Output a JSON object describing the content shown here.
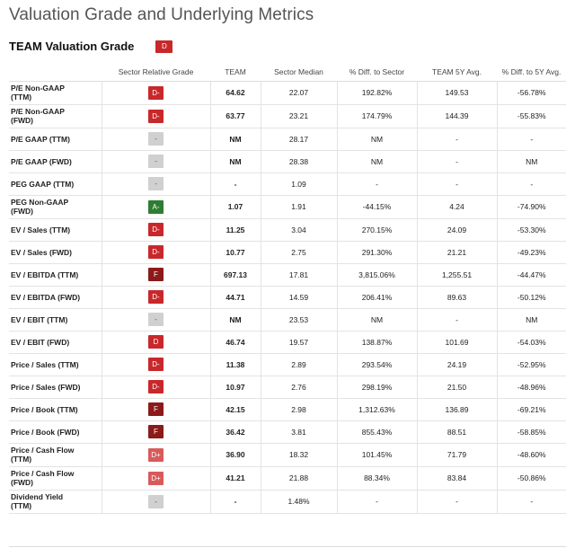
{
  "page": {
    "title": "Valuation Grade and Underlying Metrics",
    "subtitle": "TEAM Valuation Grade",
    "overall_grade": "D"
  },
  "colors": {
    "red": "#c8282b",
    "dark_red": "#8b1a1a",
    "light_red": "#d85a5a",
    "gray": "#d0d0d0",
    "green": "#2e7d32"
  },
  "table": {
    "headers": [
      "",
      "Sector Relative Grade",
      "TEAM",
      "Sector Median",
      "% Diff. to Sector",
      "TEAM 5Y Avg.",
      "% Diff. to 5Y Avg."
    ],
    "rows": [
      {
        "metric": "P/E Non-GAAP\n(TTM)",
        "grade": "D-",
        "color": "red",
        "team": "64.62",
        "median": "22.07",
        "diff_sector": "192.82%",
        "avg5y": "149.53",
        "diff_5y": "-56.78%"
      },
      {
        "metric": "P/E Non-GAAP\n(FWD)",
        "grade": "D-",
        "color": "red",
        "team": "63.77",
        "median": "23.21",
        "diff_sector": "174.79%",
        "avg5y": "144.39",
        "diff_5y": "-55.83%"
      },
      {
        "metric": "P/E GAAP (TTM)",
        "grade": "-",
        "color": "gray",
        "team": "NM",
        "median": "28.17",
        "diff_sector": "NM",
        "avg5y": "-",
        "diff_5y": "-"
      },
      {
        "metric": "P/E GAAP (FWD)",
        "grade": "-",
        "color": "gray",
        "team": "NM",
        "median": "28.38",
        "diff_sector": "NM",
        "avg5y": "-",
        "diff_5y": "NM"
      },
      {
        "metric": "PEG GAAP (TTM)",
        "grade": "-",
        "color": "gray",
        "team": "-",
        "median": "1.09",
        "diff_sector": "-",
        "avg5y": "-",
        "diff_5y": "-"
      },
      {
        "metric": "PEG Non-GAAP\n(FWD)",
        "grade": "A-",
        "color": "green",
        "team": "1.07",
        "median": "1.91",
        "diff_sector": "-44.15%",
        "avg5y": "4.24",
        "diff_5y": "-74.90%"
      },
      {
        "metric": "EV / Sales (TTM)",
        "grade": "D-",
        "color": "red",
        "team": "11.25",
        "median": "3.04",
        "diff_sector": "270.15%",
        "avg5y": "24.09",
        "diff_5y": "-53.30%"
      },
      {
        "metric": "EV / Sales (FWD)",
        "grade": "D-",
        "color": "red",
        "team": "10.77",
        "median": "2.75",
        "diff_sector": "291.30%",
        "avg5y": "21.21",
        "diff_5y": "-49.23%"
      },
      {
        "metric": "EV / EBITDA (TTM)",
        "grade": "F",
        "color": "dark_red",
        "team": "697.13",
        "median": "17.81",
        "diff_sector": "3,815.06%",
        "avg5y": "1,255.51",
        "diff_5y": "-44.47%"
      },
      {
        "metric": "EV / EBITDA (FWD)",
        "grade": "D-",
        "color": "red",
        "team": "44.71",
        "median": "14.59",
        "diff_sector": "206.41%",
        "avg5y": "89.63",
        "diff_5y": "-50.12%"
      },
      {
        "metric": "EV / EBIT (TTM)",
        "grade": "-",
        "color": "gray",
        "team": "NM",
        "median": "23.53",
        "diff_sector": "NM",
        "avg5y": "-",
        "diff_5y": "NM"
      },
      {
        "metric": "EV / EBIT (FWD)",
        "grade": "D",
        "color": "red",
        "team": "46.74",
        "median": "19.57",
        "diff_sector": "138.87%",
        "avg5y": "101.69",
        "diff_5y": "-54.03%"
      },
      {
        "metric": "Price / Sales (TTM)",
        "grade": "D-",
        "color": "red",
        "team": "11.38",
        "median": "2.89",
        "diff_sector": "293.54%",
        "avg5y": "24.19",
        "diff_5y": "-52.95%"
      },
      {
        "metric": "Price / Sales (FWD)",
        "grade": "D-",
        "color": "red",
        "team": "10.97",
        "median": "2.76",
        "diff_sector": "298.19%",
        "avg5y": "21.50",
        "diff_5y": "-48.96%"
      },
      {
        "metric": "Price / Book (TTM)",
        "grade": "F",
        "color": "dark_red",
        "team": "42.15",
        "median": "2.98",
        "diff_sector": "1,312.63%",
        "avg5y": "136.89",
        "diff_5y": "-69.21%"
      },
      {
        "metric": "Price / Book (FWD)",
        "grade": "F",
        "color": "dark_red",
        "team": "36.42",
        "median": "3.81",
        "diff_sector": "855.43%",
        "avg5y": "88.51",
        "diff_5y": "-58.85%"
      },
      {
        "metric": "Price / Cash Flow\n(TTM)",
        "grade": "D+",
        "color": "light_red",
        "team": "36.90",
        "median": "18.32",
        "diff_sector": "101.45%",
        "avg5y": "71.79",
        "diff_5y": "-48.60%"
      },
      {
        "metric": "Price / Cash Flow\n(FWD)",
        "grade": "D+",
        "color": "light_red",
        "team": "41.21",
        "median": "21.88",
        "diff_sector": "88.34%",
        "avg5y": "83.84",
        "diff_5y": "-50.86%"
      },
      {
        "metric": "Dividend Yield\n(TTM)",
        "grade": "-",
        "color": "gray",
        "team": "-",
        "median": "1.48%",
        "diff_sector": "-",
        "avg5y": "-",
        "diff_5y": "-"
      }
    ]
  }
}
